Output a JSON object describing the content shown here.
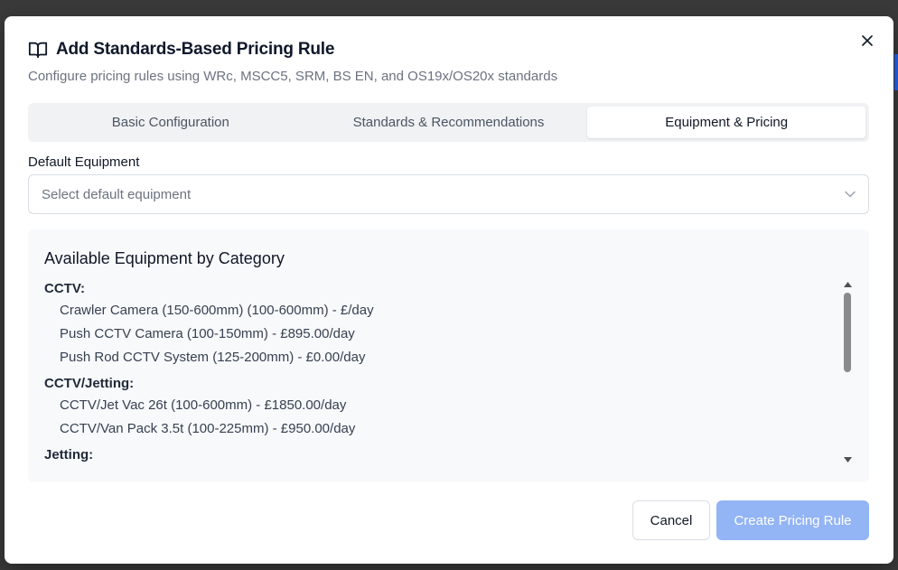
{
  "dialog": {
    "title": "Add Standards-Based Pricing Rule",
    "subtitle": "Configure pricing rules using WRc, MSCC5, SRM, BS EN, and OS19x/OS20x standards",
    "title_icon": "book-open-icon",
    "close_icon": "close-icon"
  },
  "tabs": [
    {
      "label": "Basic Configuration",
      "active": false
    },
    {
      "label": "Standards & Recommendations",
      "active": false
    },
    {
      "label": "Equipment & Pricing",
      "active": true
    }
  ],
  "default_equipment": {
    "label": "Default Equipment",
    "placeholder": "Select default equipment",
    "chevron_icon": "chevron-down-icon"
  },
  "equipment_panel": {
    "title": "Available Equipment by Category",
    "categories": [
      {
        "name": "CCTV:",
        "items": [
          "Crawler Camera (150-600mm) (100-600mm) - £/day",
          "Push CCTV Camera (100-150mm) - £895.00/day",
          "Push Rod CCTV System (125-200mm) - £0.00/day"
        ]
      },
      {
        "name": "CCTV/Jetting:",
        "items": [
          "CCTV/Jet Vac 26t (100-600mm) - £1850.00/day",
          "CCTV/Van Pack 3.5t (100-225mm) - £950.00/day"
        ]
      },
      {
        "name": "Jetting:",
        "items": []
      }
    ]
  },
  "footer": {
    "cancel_label": "Cancel",
    "create_label": "Create Pricing Rule"
  },
  "colors": {
    "primary_disabled": "#93b4f5",
    "panel_bg": "#f8f9fb",
    "tab_track": "#f1f2f4"
  }
}
